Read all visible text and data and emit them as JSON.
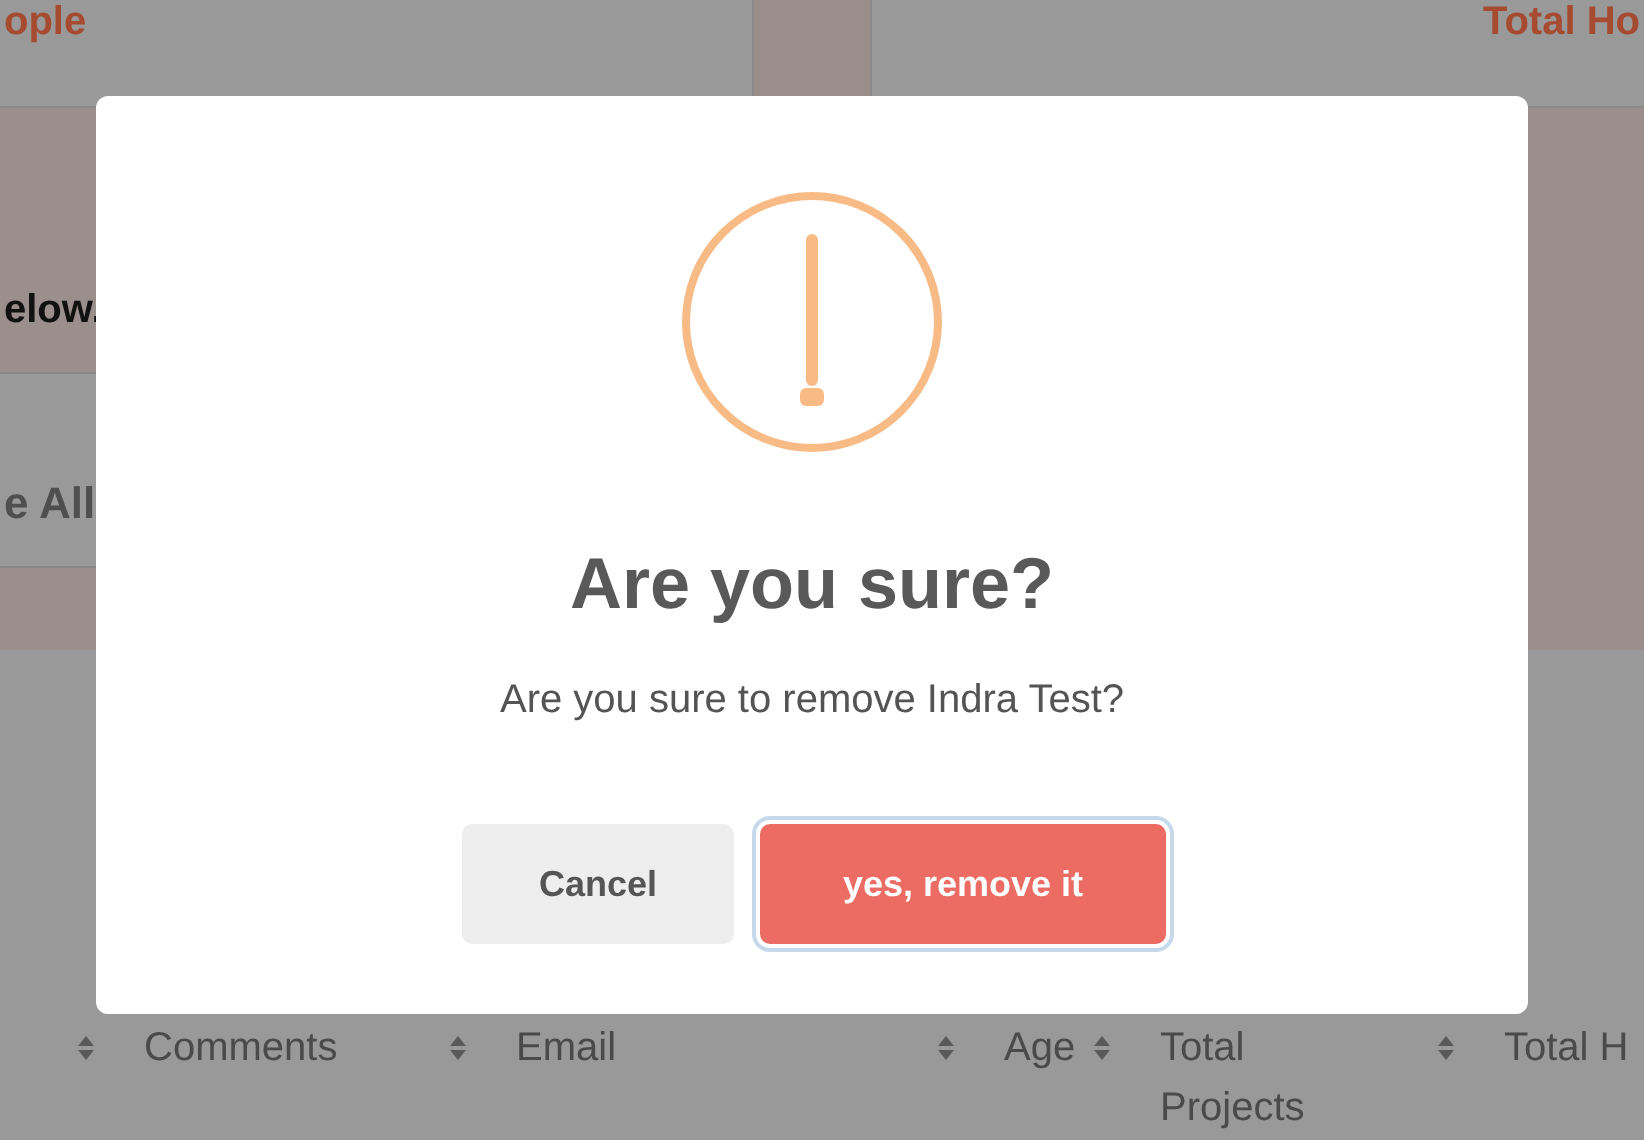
{
  "background": {
    "top_left_heading": "ople",
    "top_right_heading": "Total Ho",
    "instruction": "elow.",
    "select_all": "e All",
    "table": {
      "columns": [
        {
          "label": "Comments"
        },
        {
          "label": "Email"
        },
        {
          "label": "Age"
        },
        {
          "label": "Total Projects"
        },
        {
          "label": "Total H"
        }
      ]
    }
  },
  "dialog": {
    "title": "Are you sure?",
    "message": "Are you sure to remove Indra Test?",
    "buttons": [
      {
        "label": "Cancel",
        "kind": "cancel",
        "focused": false
      },
      {
        "label": "yes, remove it",
        "kind": "confirm",
        "focused": true
      }
    ]
  }
}
